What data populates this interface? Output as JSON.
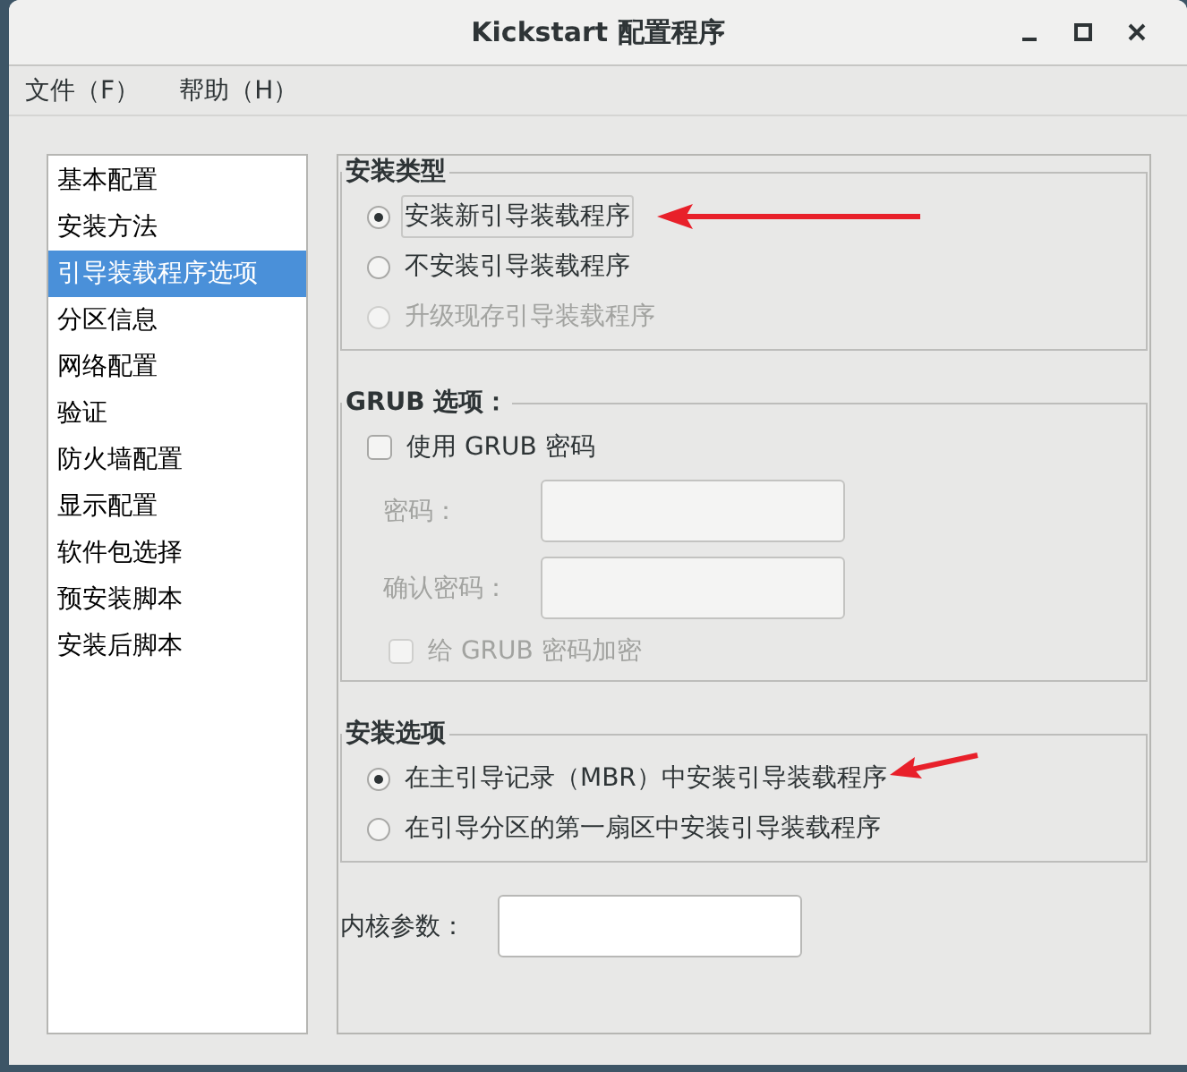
{
  "window": {
    "title": "Kickstart 配置程序"
  },
  "menu": [
    {
      "label": "文件（F）"
    },
    {
      "label": "帮助（H）"
    }
  ],
  "sidebar": {
    "items": [
      {
        "label": "基本配置",
        "selected": false
      },
      {
        "label": "安装方法",
        "selected": false
      },
      {
        "label": "引导装载程序选项",
        "selected": true
      },
      {
        "label": "分区信息",
        "selected": false
      },
      {
        "label": "网络配置",
        "selected": false
      },
      {
        "label": "验证",
        "selected": false
      },
      {
        "label": "防火墙配置",
        "selected": false
      },
      {
        "label": "显示配置",
        "selected": false
      },
      {
        "label": "软件包选择",
        "selected": false
      },
      {
        "label": "预安装脚本",
        "selected": false
      },
      {
        "label": "安装后脚本",
        "selected": false
      }
    ]
  },
  "install_type": {
    "title": "安装类型",
    "options": [
      {
        "label": "安装新引导装载程序",
        "selected": true,
        "disabled": false,
        "focused": true,
        "marked": true
      },
      {
        "label": "不安装引导装载程序",
        "selected": false,
        "disabled": false,
        "focused": false,
        "marked": false
      },
      {
        "label": "升级现存引导装载程序",
        "selected": false,
        "disabled": true,
        "focused": false,
        "marked": false
      }
    ]
  },
  "grub_options": {
    "title": "GRUB 选项：",
    "use_password": {
      "label": "使用  GRUB 密码",
      "checked": false
    },
    "fields": [
      {
        "label": "密码：",
        "disabled": true
      },
      {
        "label": "确认密码：",
        "disabled": true
      }
    ],
    "encrypt": {
      "label": "给  GRUB 密码加密",
      "checked": false,
      "disabled": true
    }
  },
  "install_options": {
    "title": "安装选项",
    "options": [
      {
        "label": "在主引导记录（MBR）中安装引导装载程序",
        "selected": true,
        "disabled": false,
        "focused": false,
        "marked": true
      },
      {
        "label": "在引导分区的第一扇区中安装引导装载程序",
        "selected": false,
        "disabled": false,
        "focused": false,
        "marked": false
      }
    ]
  },
  "kernel_params": {
    "label": "内核参数："
  }
}
